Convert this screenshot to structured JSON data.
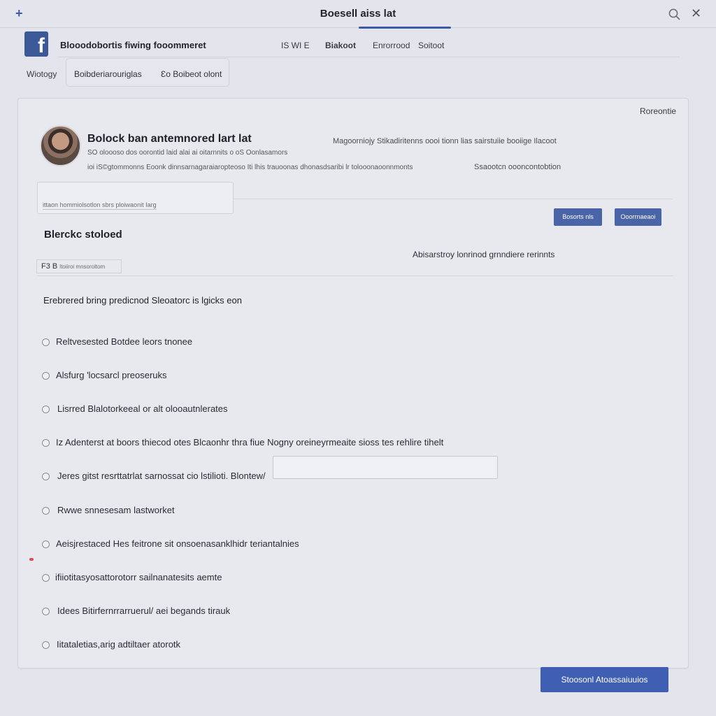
{
  "window": {
    "title": "Boesell aiss lat",
    "plus_glyph": "+",
    "close_glyph": "✕",
    "search_icon": "search-icon"
  },
  "nav": {
    "logo_letter": "f",
    "title": "Blooodobortis fiwing fooommeret",
    "links": [
      "IS WI E",
      "Biakoot",
      "Enrorrood",
      "Soitoot"
    ]
  },
  "subnav": {
    "left": "Wiotogy",
    "box_a": "Boibderiarouriglas",
    "box_b": "Ɛo Boibeot olont"
  },
  "card": {
    "corner_link": "Roreontie",
    "profile": {
      "name": "Bolock ban antemnored lart lat",
      "meta1": "SO oloooso dos oorontid laid alai ai oitarnnits o oS Oonlasamors",
      "meta2": "ioi iS©gtommonns Eoonk dinnsarnagaraiaropteoso Iti lhis trauoonas dhonasdsaribi lr tolooonaoonnmonts",
      "right1": "Magoorniojy Stikadiritenns oooi tionn lias sairstuiie booiige Ilacoot",
      "right2": "Ssaootcn oooncontobtion"
    },
    "input_text": "ittaon hommiolsotlon sbrs ploiwaonit Iarg",
    "buttons": [
      "Bosorts nls",
      "Ooorrnaeaoi"
    ],
    "section_title": "Blerckc stoloed",
    "section_right": "Abisarstroy lonrinod grnndiere rerinnts",
    "tag": "F3 B",
    "tag_small": "ltoiiroi mnsoroltom",
    "question": "Erebrered bring predicnod Sleoatorc is lgicks eon",
    "options": [
      "Reltvesested Botdee leors tnonee",
      "Alsfurg 'locsarcl preoseruks",
      "Lisrred Blalotorkeeal or alt olooautnlerates",
      "Iz Adenterst at boors thiecod otes Blcaonhr thra fiue Nogny oreineyrmeaite sioss tes rehlire tihelt",
      "Jeres gitst resrttatrlat sarnossat cio lstilioti. Blontew/",
      "Rwwe snnesesam lastworket",
      "Aeisjrestaced Hes feitrone sit onsoenasanklhidr teriantalnies",
      "ifiiotitasyosattorotorr sailnanatesits aemte",
      "Idees Bitirfernrrarruerul/ aei begands tirauk",
      "Iitataletias,arig adtiltaer atorotk"
    ]
  },
  "primary_button": "Stoosonl Atoassaiuuios"
}
